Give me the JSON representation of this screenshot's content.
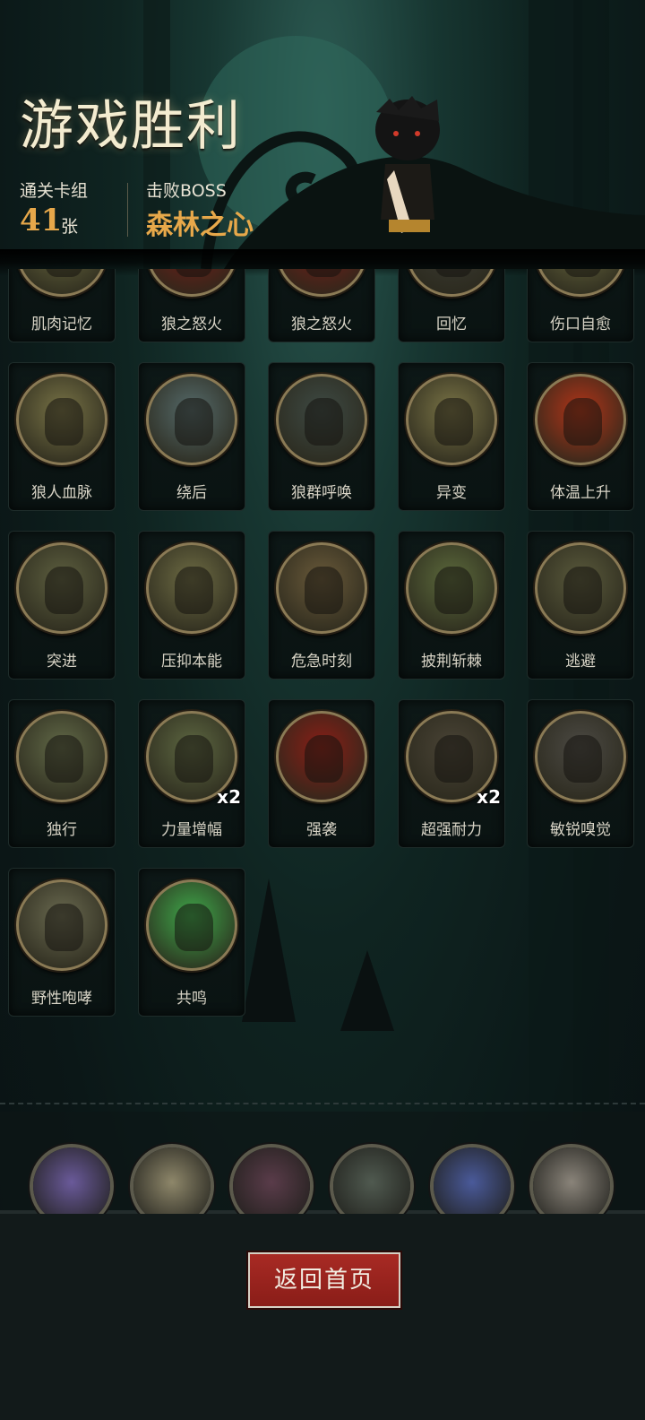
{
  "header": {
    "title": "游戏胜利",
    "cards_label": "通关卡组",
    "cards_count": "41",
    "cards_unit": "张",
    "boss_label": "击败BOSS",
    "boss_name": "森林之心"
  },
  "cards": [
    {
      "name": "肌肉记忆",
      "icon": "muscle-memory-icon",
      "tone": "#6b6a40"
    },
    {
      "name": "狼之怒火",
      "icon": "wolf-rage-icon",
      "tone": "#7a1c16"
    },
    {
      "name": "狼之怒火",
      "icon": "wolf-rage-icon",
      "tone": "#7a1c16"
    },
    {
      "name": "回忆",
      "icon": "recall-icon",
      "tone": "#3c3c34"
    },
    {
      "name": "伤口自愈",
      "icon": "wound-heal-icon",
      "tone": "#6b6a40"
    },
    {
      "name": "狼人血脉",
      "icon": "werewolf-blood-icon",
      "tone": "#787346"
    },
    {
      "name": "绕后",
      "icon": "flank-icon",
      "tone": "#556a6a"
    },
    {
      "name": "狼群呼唤",
      "icon": "pack-call-icon",
      "tone": "#3e4a44"
    },
    {
      "name": "异变",
      "icon": "mutation-icon",
      "tone": "#7a7446"
    },
    {
      "name": "体温上升",
      "icon": "body-heat-icon",
      "tone": "#b23418"
    },
    {
      "name": "突进",
      "icon": "charge-icon",
      "tone": "#5e6040"
    },
    {
      "name": "压抑本能",
      "icon": "suppress-instinct-icon",
      "tone": "#6e6c44"
    },
    {
      "name": "危急时刻",
      "icon": "critical-moment-icon",
      "tone": "#6a5a3a"
    },
    {
      "name": "披荆斩棘",
      "icon": "blaze-trail-icon",
      "tone": "#5c6a3c"
    },
    {
      "name": "逃避",
      "icon": "escape-icon",
      "tone": "#5a5a3c"
    },
    {
      "name": "独行",
      "icon": "lone-walk-icon",
      "tone": "#626a48"
    },
    {
      "name": "力量增幅",
      "icon": "power-boost-icon",
      "tone": "#5e6842",
      "badge": "x2"
    },
    {
      "name": "强袭",
      "icon": "assault-icon",
      "tone": "#8a1e16"
    },
    {
      "name": "超强耐力",
      "icon": "endurance-icon",
      "tone": "#4a4436",
      "badge": "x2"
    },
    {
      "name": "敏锐嗅觉",
      "icon": "keen-smell-icon",
      "tone": "#4c4a44"
    },
    {
      "name": "野性咆哮",
      "icon": "wild-roar-icon",
      "tone": "#6a6a50"
    },
    {
      "name": "共鸣",
      "icon": "resonance-icon",
      "tone": "#3fa84a"
    }
  ],
  "relics": [
    {
      "icon": "purple-tentacle-icon",
      "tone": "#6a5a9a"
    },
    {
      "icon": "vip-ticket-icon",
      "tone": "#8e876a"
    },
    {
      "icon": "spell-book-icon",
      "tone": "#5a3c4a"
    },
    {
      "icon": "wolf-warrior-icon",
      "tone": "#505a50"
    },
    {
      "icon": "red-cape-hero-icon",
      "tone": "#4a5a9a"
    },
    {
      "icon": "monkey-icon",
      "tone": "#8a847a"
    }
  ],
  "footer": {
    "home_button_label": "返回首页"
  }
}
